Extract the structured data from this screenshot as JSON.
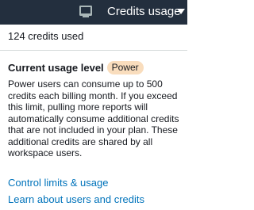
{
  "topbar": {
    "icon": "monitor-icon",
    "label": "Credits usage",
    "caret_icon": "caret-down-icon",
    "background_color": "#232f3e"
  },
  "summary": {
    "credits_used_text": "124 credits used"
  },
  "usage_level": {
    "title": "Current usage level",
    "badge": "Power",
    "badge_color": "#f9ddbd",
    "description": "Power users can consume up to 500 credits each billing month. If you exceed this limit, pulling more reports will automatically consume additional credits that are not included in your plan. These additional credits are shared by all workspace users."
  },
  "links": {
    "control_limits": "Control limits & usage",
    "learn_more": "Learn about users and credits",
    "link_color": "#0073bb"
  }
}
